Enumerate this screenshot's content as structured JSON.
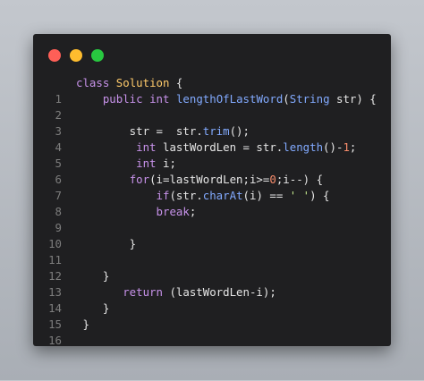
{
  "window": {
    "controls": [
      {
        "name": "close",
        "color": "#ff5f57"
      },
      {
        "name": "minimize",
        "color": "#febc2e"
      },
      {
        "name": "zoom",
        "color": "#28c840"
      }
    ]
  },
  "code": {
    "lines": [
      {
        "n": "1",
        "text": "class Solution {"
      },
      {
        "n": "2",
        "text": "    public int lengthOfLastWord(String str) {"
      },
      {
        "n": "3",
        "text": ""
      },
      {
        "n": "4",
        "text": "        str =  str.trim();"
      },
      {
        "n": "5",
        "text": "         int lastWordLen = str.length()-1;"
      },
      {
        "n": "6",
        "text": "         int i;"
      },
      {
        "n": "7",
        "text": "        for(i=lastWordLen;i>=0;i--) {"
      },
      {
        "n": "8",
        "text": "            if(str.charAt(i) == ' ') {"
      },
      {
        "n": "9",
        "text": "            break;"
      },
      {
        "n": "10",
        "text": ""
      },
      {
        "n": "11",
        "text": "        }"
      },
      {
        "n": "12",
        "text": ""
      },
      {
        "n": "13",
        "text": "    }"
      },
      {
        "n": "14",
        "text": "       return (lastWordLen-i);"
      },
      {
        "n": "15",
        "text": "    }"
      },
      {
        "n": "16",
        "text": " }"
      }
    ]
  },
  "colors": {
    "keyword": "#c792ea",
    "type": "#82aaff",
    "function": "#82aaff",
    "class": "#ffcb6b",
    "string": "#c3e88d",
    "number": "#f78c6c",
    "text": "#e6e6e6",
    "line_number": "#7d7d7d",
    "window_bg": "#1f1f21"
  }
}
